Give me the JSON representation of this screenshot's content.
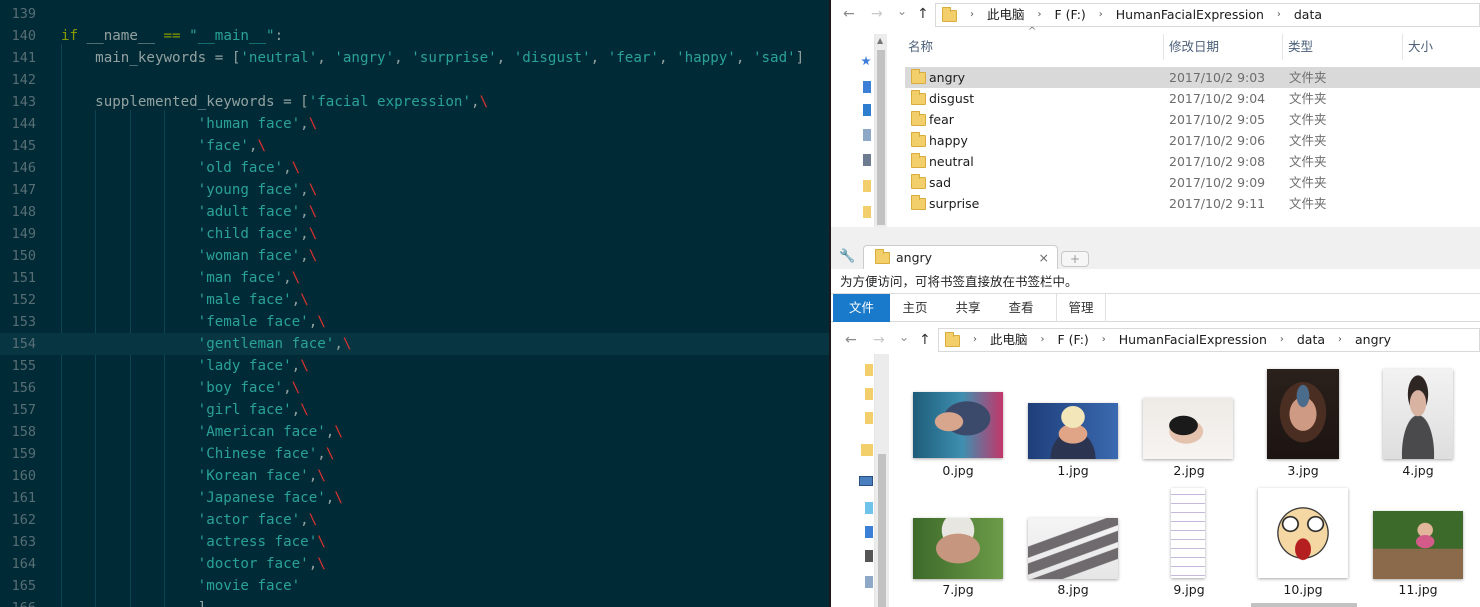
{
  "editor": {
    "lines": [
      {
        "num": "139",
        "parts": []
      },
      {
        "num": "140",
        "parts": [
          [
            "kw",
            "if"
          ],
          [
            "plain",
            " __name__ "
          ],
          [
            "kw",
            "=="
          ],
          [
            "plain",
            " "
          ],
          [
            "str",
            "\"__main__\""
          ],
          [
            "plain",
            ":"
          ]
        ]
      },
      {
        "num": "141",
        "parts": [
          [
            "plain",
            "    main_keywords = ["
          ],
          [
            "str",
            "'neutral'"
          ],
          [
            "plain",
            ", "
          ],
          [
            "str",
            "'angry'"
          ],
          [
            "plain",
            ", "
          ],
          [
            "str",
            "'surprise'"
          ],
          [
            "plain",
            ", "
          ],
          [
            "str",
            "'disgust'"
          ],
          [
            "plain",
            ", "
          ],
          [
            "str",
            "'fear'"
          ],
          [
            "plain",
            ", "
          ],
          [
            "str",
            "'happy'"
          ],
          [
            "plain",
            ", "
          ],
          [
            "str",
            "'sad'"
          ],
          [
            "plain",
            "]"
          ]
        ]
      },
      {
        "num": "142",
        "parts": []
      },
      {
        "num": "143",
        "parts": [
          [
            "plain",
            "    supplemented_keywords = ["
          ],
          [
            "str",
            "'facial expression'"
          ],
          [
            "plain",
            ","
          ],
          [
            "bs",
            "\\"
          ]
        ]
      },
      {
        "num": "144",
        "parts": [
          [
            "plain",
            "                "
          ],
          [
            "str",
            "'human face'"
          ],
          [
            "plain",
            ","
          ],
          [
            "bs",
            "\\"
          ]
        ]
      },
      {
        "num": "145",
        "parts": [
          [
            "plain",
            "                "
          ],
          [
            "str",
            "'face'"
          ],
          [
            "plain",
            ","
          ],
          [
            "bs",
            "\\"
          ]
        ]
      },
      {
        "num": "146",
        "parts": [
          [
            "plain",
            "                "
          ],
          [
            "str",
            "'old face'"
          ],
          [
            "plain",
            ","
          ],
          [
            "bs",
            "\\"
          ]
        ]
      },
      {
        "num": "147",
        "parts": [
          [
            "plain",
            "                "
          ],
          [
            "str",
            "'young face'"
          ],
          [
            "plain",
            ","
          ],
          [
            "bs",
            "\\"
          ]
        ]
      },
      {
        "num": "148",
        "parts": [
          [
            "plain",
            "                "
          ],
          [
            "str",
            "'adult face'"
          ],
          [
            "plain",
            ","
          ],
          [
            "bs",
            "\\"
          ]
        ]
      },
      {
        "num": "149",
        "parts": [
          [
            "plain",
            "                "
          ],
          [
            "str",
            "'child face'"
          ],
          [
            "plain",
            ","
          ],
          [
            "bs",
            "\\"
          ]
        ]
      },
      {
        "num": "150",
        "parts": [
          [
            "plain",
            "                "
          ],
          [
            "str",
            "'woman face'"
          ],
          [
            "plain",
            ","
          ],
          [
            "bs",
            "\\"
          ]
        ]
      },
      {
        "num": "151",
        "parts": [
          [
            "plain",
            "                "
          ],
          [
            "str",
            "'man face'"
          ],
          [
            "plain",
            ","
          ],
          [
            "bs",
            "\\"
          ]
        ]
      },
      {
        "num": "152",
        "parts": [
          [
            "plain",
            "                "
          ],
          [
            "str",
            "'male face'"
          ],
          [
            "plain",
            ","
          ],
          [
            "bs",
            "\\"
          ]
        ]
      },
      {
        "num": "153",
        "parts": [
          [
            "plain",
            "                "
          ],
          [
            "str",
            "'female face'"
          ],
          [
            "plain",
            ","
          ],
          [
            "bs",
            "\\"
          ]
        ]
      },
      {
        "num": "154",
        "parts": [
          [
            "plain",
            "                "
          ],
          [
            "str",
            "'gentleman face'"
          ],
          [
            "plain",
            ","
          ],
          [
            "bs",
            "\\"
          ]
        ],
        "highlight": true
      },
      {
        "num": "155",
        "parts": [
          [
            "plain",
            "                "
          ],
          [
            "str",
            "'lady face'"
          ],
          [
            "plain",
            ","
          ],
          [
            "bs",
            "\\"
          ]
        ]
      },
      {
        "num": "156",
        "parts": [
          [
            "plain",
            "                "
          ],
          [
            "str",
            "'boy face'"
          ],
          [
            "plain",
            ","
          ],
          [
            "bs",
            "\\"
          ]
        ]
      },
      {
        "num": "157",
        "parts": [
          [
            "plain",
            "                "
          ],
          [
            "str",
            "'girl face'"
          ],
          [
            "plain",
            ","
          ],
          [
            "bs",
            "\\"
          ]
        ]
      },
      {
        "num": "158",
        "parts": [
          [
            "plain",
            "                "
          ],
          [
            "str",
            "'American face'"
          ],
          [
            "plain",
            ","
          ],
          [
            "bs",
            "\\"
          ]
        ]
      },
      {
        "num": "159",
        "parts": [
          [
            "plain",
            "                "
          ],
          [
            "str",
            "'Chinese face'"
          ],
          [
            "plain",
            ","
          ],
          [
            "bs",
            "\\"
          ]
        ]
      },
      {
        "num": "160",
        "parts": [
          [
            "plain",
            "                "
          ],
          [
            "str",
            "'Korean face'"
          ],
          [
            "plain",
            ","
          ],
          [
            "bs",
            "\\"
          ]
        ]
      },
      {
        "num": "161",
        "parts": [
          [
            "plain",
            "                "
          ],
          [
            "str",
            "'Japanese face'"
          ],
          [
            "plain",
            ","
          ],
          [
            "bs",
            "\\"
          ]
        ]
      },
      {
        "num": "162",
        "parts": [
          [
            "plain",
            "                "
          ],
          [
            "str",
            "'actor face'"
          ],
          [
            "plain",
            ","
          ],
          [
            "bs",
            "\\"
          ]
        ]
      },
      {
        "num": "163",
        "parts": [
          [
            "plain",
            "                "
          ],
          [
            "str",
            "'actress face'"
          ],
          [
            "bs",
            "\\"
          ]
        ]
      },
      {
        "num": "164",
        "parts": [
          [
            "plain",
            "                "
          ],
          [
            "str",
            "'doctor face'"
          ],
          [
            "plain",
            ","
          ],
          [
            "bs",
            "\\"
          ]
        ]
      },
      {
        "num": "165",
        "parts": [
          [
            "plain",
            "                "
          ],
          [
            "str",
            "'movie face'"
          ]
        ]
      },
      {
        "num": "166",
        "parts": [
          [
            "plain",
            "                ]"
          ]
        ]
      }
    ],
    "colors": {
      "background": "#002b36",
      "keyword": "#859900",
      "string": "#2aa198",
      "escape": "#dc322f",
      "text": "#93a1a1",
      "gutter": "#586e75"
    }
  },
  "top_explorer": {
    "nav": {
      "back": "←",
      "forward": "→",
      "dropdown": "⌄",
      "up": "↑"
    },
    "address": [
      "此电脑",
      "F (F:)",
      "HumanFacialExpression",
      "data"
    ],
    "columns": {
      "name": "名称",
      "date": "修改日期",
      "type": "类型",
      "size": "大小"
    },
    "files": [
      {
        "name": "angry",
        "date": "2017/10/2 9:03",
        "type": "文件夹",
        "selected": true
      },
      {
        "name": "disgust",
        "date": "2017/10/2 9:04",
        "type": "文件夹"
      },
      {
        "name": "fear",
        "date": "2017/10/2 9:05",
        "type": "文件夹"
      },
      {
        "name": "happy",
        "date": "2017/10/2 9:06",
        "type": "文件夹"
      },
      {
        "name": "neutral",
        "date": "2017/10/2 9:08",
        "type": "文件夹"
      },
      {
        "name": "sad",
        "date": "2017/10/2 9:09",
        "type": "文件夹"
      },
      {
        "name": "surprise",
        "date": "2017/10/2 9:11",
        "type": "文件夹"
      }
    ]
  },
  "browser": {
    "tab_title": "angry",
    "close": "×",
    "new_tab": "+",
    "bookmark_hint": "为方便访问，可将书签直接放在书签栏中。"
  },
  "bottom_explorer": {
    "ribbon_tabs": [
      "文件",
      "主页",
      "共享",
      "查看",
      "管理"
    ],
    "address": [
      "此电脑",
      "F (F:)",
      "HumanFacialExpression",
      "data",
      "angry"
    ],
    "thumbnails": [
      {
        "label": "0.jpg"
      },
      {
        "label": "1.jpg"
      },
      {
        "label": "2.jpg"
      },
      {
        "label": "3.jpg"
      },
      {
        "label": "4.jpg"
      },
      {
        "label": "7.jpg"
      },
      {
        "label": "8.jpg"
      },
      {
        "label": "9.jpg"
      },
      {
        "label": "10.jpg"
      },
      {
        "label": "11.jpg"
      }
    ]
  }
}
